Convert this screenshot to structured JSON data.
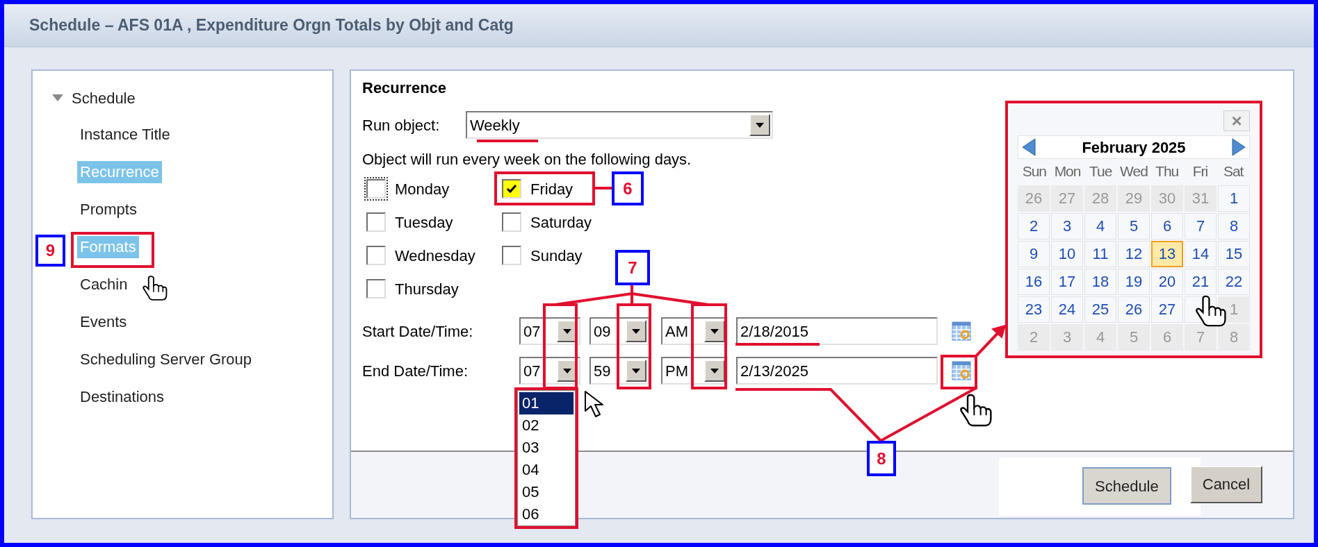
{
  "window": {
    "title": "Schedule – AFS 01A , Expenditure Orgn Totals by Objt and Catg"
  },
  "sidebar": {
    "label": "Schedule",
    "expanded": true,
    "children": [
      {
        "label": "Instance Title",
        "selected": false
      },
      {
        "label": "Recurrence",
        "selected": true
      },
      {
        "label": "Prompts",
        "selected": false
      },
      {
        "label": "Formats",
        "selected": true
      },
      {
        "label": "Cachin",
        "selected": false
      },
      {
        "label": "Events",
        "selected": false
      },
      {
        "label": "Scheduling Server Group",
        "selected": false
      },
      {
        "label": "Destinations",
        "selected": false
      }
    ]
  },
  "recurrence": {
    "heading": "Recurrence",
    "run_object_label": "Run object:",
    "run_object_value": "Weekly",
    "description": "Object will run every week on the following days.",
    "days": [
      {
        "label": "Monday",
        "checked": false,
        "focused": true
      },
      {
        "label": "Friday",
        "checked": true,
        "focused": false
      },
      {
        "label": "Tuesday",
        "checked": false,
        "focused": false
      },
      {
        "label": "Saturday",
        "checked": false,
        "focused": false
      },
      {
        "label": "Wednesday",
        "checked": false,
        "focused": false
      },
      {
        "label": "Sunday",
        "checked": false,
        "focused": false
      },
      {
        "label": "Thursday",
        "checked": false,
        "focused": false
      }
    ],
    "times": [
      {
        "label": "Start Date/Time:",
        "hour": "07",
        "minute": "09",
        "ampm": "AM",
        "date": "2/18/2015"
      },
      {
        "label": "End Date/Time:",
        "hour": "07",
        "minute": "59",
        "ampm": "PM",
        "date": "2/13/2025"
      }
    ]
  },
  "hour_list": [
    {
      "label": "01",
      "selected": true
    },
    {
      "label": "02",
      "selected": false
    },
    {
      "label": "03",
      "selected": false
    },
    {
      "label": "04",
      "selected": false
    },
    {
      "label": "05",
      "selected": false
    },
    {
      "label": "06",
      "selected": false
    }
  ],
  "calendar": {
    "close": "×",
    "month": "February 2025",
    "weekdays": [
      "Sun",
      "Mon",
      "Tue",
      "Wed",
      "Thu",
      "Fri",
      "Sat"
    ],
    "weeks": [
      [
        {
          "day": "26",
          "outside": true,
          "selected": false
        },
        {
          "day": "27",
          "outside": true,
          "selected": false
        },
        {
          "day": "28",
          "outside": true,
          "selected": false
        },
        {
          "day": "29",
          "outside": true,
          "selected": false
        },
        {
          "day": "30",
          "outside": true,
          "selected": false
        },
        {
          "day": "31",
          "outside": true,
          "selected": false
        },
        {
          "day": "1",
          "outside": false,
          "selected": false
        }
      ],
      [
        {
          "day": "2",
          "outside": false,
          "selected": false
        },
        {
          "day": "3",
          "outside": false,
          "selected": false
        },
        {
          "day": "4",
          "outside": false,
          "selected": false
        },
        {
          "day": "5",
          "outside": false,
          "selected": false
        },
        {
          "day": "6",
          "outside": false,
          "selected": false
        },
        {
          "day": "7",
          "outside": false,
          "selected": false
        },
        {
          "day": "8",
          "outside": false,
          "selected": false
        }
      ],
      [
        {
          "day": "9",
          "outside": false,
          "selected": false
        },
        {
          "day": "10",
          "outside": false,
          "selected": false
        },
        {
          "day": "11",
          "outside": false,
          "selected": false
        },
        {
          "day": "12",
          "outside": false,
          "selected": false
        },
        {
          "day": "13",
          "outside": false,
          "selected": true
        },
        {
          "day": "14",
          "outside": false,
          "selected": false
        },
        {
          "day": "15",
          "outside": false,
          "selected": false
        }
      ],
      [
        {
          "day": "16",
          "outside": false,
          "selected": false
        },
        {
          "day": "17",
          "outside": false,
          "selected": false
        },
        {
          "day": "18",
          "outside": false,
          "selected": false
        },
        {
          "day": "19",
          "outside": false,
          "selected": false
        },
        {
          "day": "20",
          "outside": false,
          "selected": false
        },
        {
          "day": "21",
          "outside": false,
          "selected": false
        },
        {
          "day": "22",
          "outside": false,
          "selected": false
        }
      ],
      [
        {
          "day": "23",
          "outside": false,
          "selected": false
        },
        {
          "day": "24",
          "outside": false,
          "selected": false
        },
        {
          "day": "25",
          "outside": false,
          "selected": false
        },
        {
          "day": "26",
          "outside": false,
          "selected": false
        },
        {
          "day": "27",
          "outside": false,
          "selected": false
        },
        {
          "outside": false,
          "selected": false
        },
        {
          "day": "1",
          "outside": true,
          "selected": false
        }
      ],
      [
        {
          "day": "2",
          "outside": true,
          "selected": false
        },
        {
          "day": "3",
          "outside": true,
          "selected": false
        },
        {
          "day": "4",
          "outside": true,
          "selected": false
        },
        {
          "day": "5",
          "outside": true,
          "selected": false
        },
        {
          "day": "6",
          "outside": true,
          "selected": false
        },
        {
          "day": "7",
          "outside": true,
          "selected": false
        },
        {
          "day": "8",
          "outside": true,
          "selected": false
        }
      ]
    ]
  },
  "buttons": [
    {
      "label": "Schedule",
      "default": true
    },
    {
      "label": "Cancel",
      "default": false
    }
  ],
  "annotations": [
    {
      "label": "6"
    },
    {
      "label": "7"
    },
    {
      "label": "8"
    },
    {
      "label": "9"
    }
  ]
}
